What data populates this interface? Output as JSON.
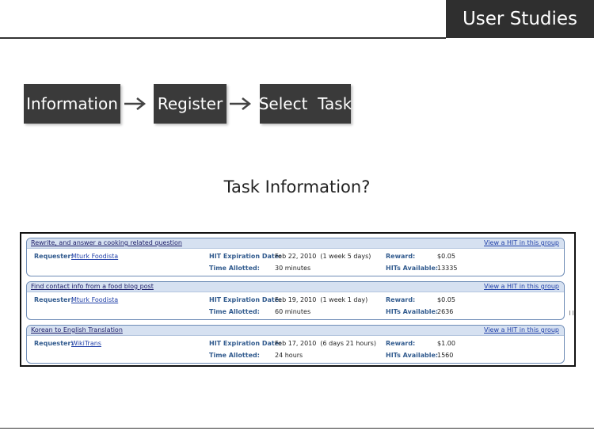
{
  "slide": {
    "title": "User Studies",
    "subtitle": "Task Information?"
  },
  "flow": {
    "steps": [
      "Information",
      "Register",
      "Select  Task"
    ]
  },
  "labels": {
    "requester": "Requester:",
    "expiration": "HIT Expiration Date:",
    "time_allotted": "Time Allotted:",
    "reward": "Reward:",
    "hits_available": "HITs Available:",
    "view_link": "View a HIT in this group"
  },
  "hits": [
    {
      "title": "Rewrite, and answer a cooking related question",
      "requester": "Mturk Foodista",
      "expiration": "Feb 22, 2010  (1 week 5 days)",
      "time_allotted": "30 minutes",
      "reward": "$0.05",
      "hits_available": "13335"
    },
    {
      "title": "Find contact info from a food blog post",
      "requester": "Mturk Foodista",
      "expiration": "Feb 19, 2010  (1 week 1 day)",
      "time_allotted": "60 minutes",
      "reward": "$0.05",
      "hits_available": "2636"
    },
    {
      "title": "Korean to English Translation",
      "requester": "WikiTrans",
      "expiration": "Feb 17, 2010  (6 days 21 hours)",
      "time_allotted": "24 hours",
      "reward": "$1.00",
      "hits_available": "1560"
    }
  ]
}
